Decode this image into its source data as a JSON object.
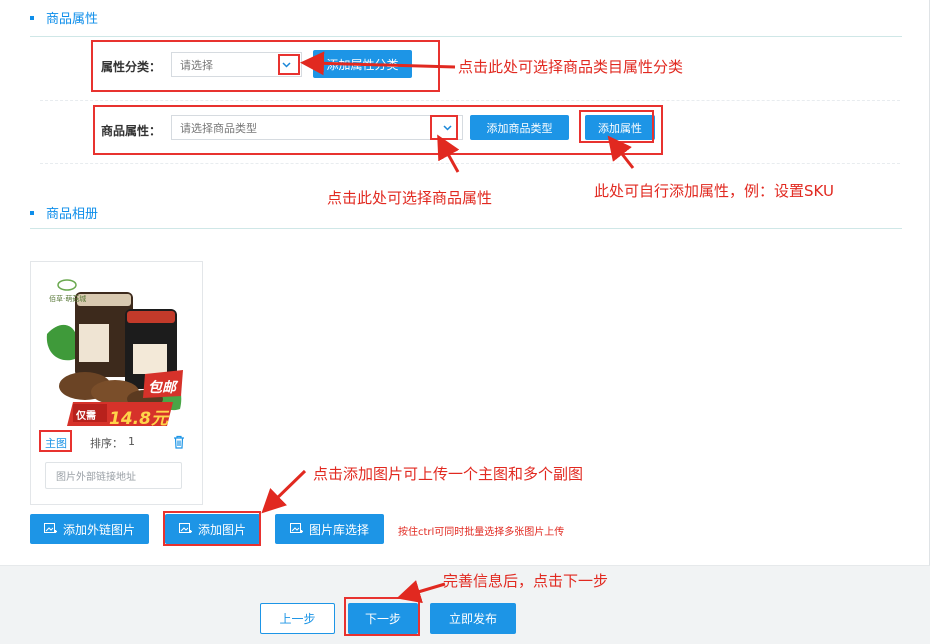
{
  "sections": {
    "attributes_title": "商品属性",
    "album_title": "商品相册"
  },
  "attribute_category": {
    "label": "属性分类：",
    "selected": "请选择",
    "add_button": "添加属性分类"
  },
  "product_attribute": {
    "label": "商品属性：",
    "selected": "请选择商品类型",
    "add_type_button": "添加商品类型",
    "add_attr_button": "添加属性"
  },
  "album": {
    "image_tag": "主图",
    "sort_label": "排序：",
    "sort_value": "1",
    "link_placeholder": "图片外部链接地址",
    "product_image_text": {
      "brand": "佰草·萌菇城",
      "badge": "包邮",
      "price_prefix": "仅需",
      "price": "14.8元"
    }
  },
  "upload_buttons": {
    "external": "添加外链图片",
    "add_image": "添加图片",
    "library": "图片库选择"
  },
  "hint_text": "按住ctrl可同时批量选择多张图片上传",
  "footer_buttons": {
    "prev": "上一步",
    "next": "下一步",
    "publish": "立即发布"
  },
  "annotations": {
    "category": "点击此处可选择商品类目属性分类",
    "attribute": "点击此处可选择商品属性",
    "add_attr": "此处可自行添加属性，例：设置SKU",
    "upload": "点击添加图片可上传一个主图和多个副图",
    "next_step": "完善信息后，点击下一步"
  },
  "colors": {
    "accent": "#1d95e6",
    "annotation_red": "#e12920"
  }
}
